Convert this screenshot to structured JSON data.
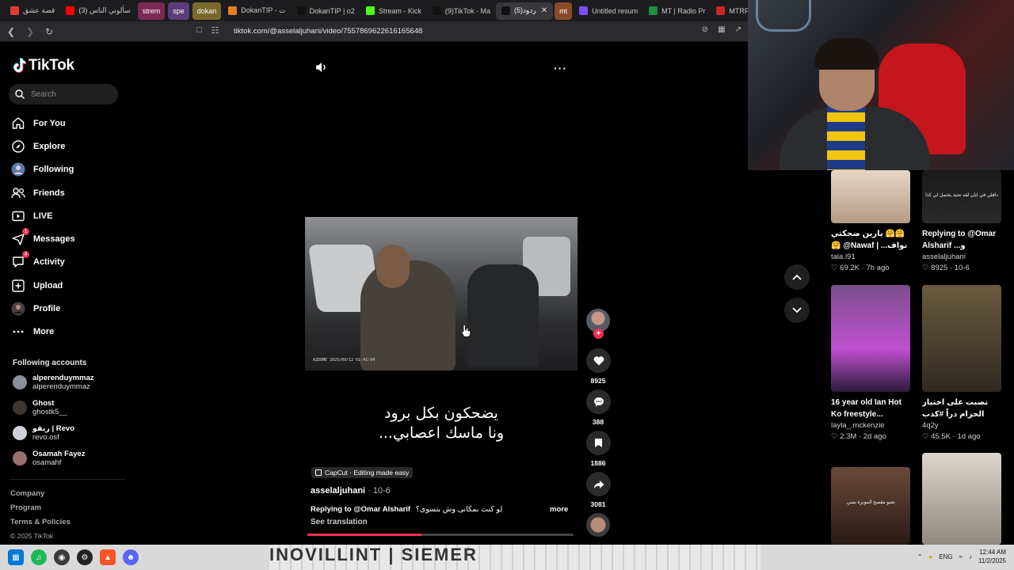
{
  "browser": {
    "tabs": [
      {
        "label": "قصة عشق",
        "color": "#e53935",
        "type": "tab"
      },
      {
        "label": "(3) سألوني الناس",
        "color": "#ff0000",
        "type": "tab"
      },
      {
        "label": "strem",
        "color": "#7a2a55",
        "type": "chip"
      },
      {
        "label": "spe",
        "color": "#5a3d7a",
        "type": "chip"
      },
      {
        "label": "dokan",
        "color": "#7a6a2a",
        "type": "chip"
      },
      {
        "label": "DokanTIP - ت",
        "color": "#e67e22",
        "type": "tab"
      },
      {
        "label": "DokanTIP | o2",
        "color": "#111111",
        "type": "tab"
      },
      {
        "label": "Stream - Kick",
        "color": "#53fc18",
        "type": "tab"
      },
      {
        "label": "(9)TikTok - Ma",
        "color": "#111111",
        "type": "tab"
      },
      {
        "label": "(5)ردود",
        "color": "#111111",
        "type": "active"
      },
      {
        "label": "mt",
        "color": "#8a4a2a",
        "type": "chip"
      },
      {
        "label": "Untitled resum",
        "color": "#7c4dff",
        "type": "tab"
      },
      {
        "label": "MT | Radio Pr",
        "color": "#1e8e3e",
        "type": "tab"
      },
      {
        "label": "MTRP",
        "color": "#c62828",
        "type": "tab"
      }
    ],
    "url": "tiktok.com/@asselaljuhani/video/7557869622616165648"
  },
  "sidebar": {
    "brand": "TikTok",
    "search_placeholder": "Search",
    "nav": [
      {
        "label": "For You",
        "icon": "home-icon"
      },
      {
        "label": "Explore",
        "icon": "compass-icon"
      },
      {
        "label": "Following",
        "icon": "following-avatar-icon"
      },
      {
        "label": "Friends",
        "icon": "friends-icon"
      },
      {
        "label": "LIVE",
        "icon": "live-icon"
      },
      {
        "label": "Messages",
        "icon": "messages-icon",
        "badge": "1"
      },
      {
        "label": "Activity",
        "icon": "activity-icon",
        "badge": "4"
      },
      {
        "label": "Upload",
        "icon": "upload-icon"
      },
      {
        "label": "Profile",
        "icon": "profile-avatar-icon"
      },
      {
        "label": "More",
        "icon": "more-icon"
      }
    ],
    "following_title": "Following accounts",
    "accounts": [
      {
        "name": "alperenduymmaz",
        "handle": "alperenduymmaz",
        "color": "#8a8f99"
      },
      {
        "name": "Ghost",
        "handle": "ghostk5__",
        "color": "#3d3530"
      },
      {
        "name": "ريفو | Revo",
        "handle": "revo.osf",
        "color": "#d0d4da"
      },
      {
        "name": "Osamah Fayez",
        "handle": "osamahf",
        "color": "#9a6f6f"
      }
    ],
    "footer": [
      "Company",
      "Program",
      "Terms & Policies"
    ],
    "copyright": "© 2025 TikTok"
  },
  "video": {
    "caption_line1": "يضحكون بكل برود",
    "caption_line2": "ونا ماسك اعصابي...",
    "capcut_label": "CapCut · Editing made easy",
    "author": "asselaljuhani",
    "date": "10-6",
    "reply_prefix": "Replying to @Omar Alsharif",
    "reply_text": "لو كنت بمكانى وش بتسوى؟",
    "more_label": "more",
    "see_translation": "See translation",
    "progress_fraction": 0.43,
    "stamp": "AZDOME 2025/09/12 01:41:04"
  },
  "actions": {
    "likes": "8925",
    "comments": "388",
    "saves": "1886",
    "shares": "3081"
  },
  "suggestions": [
    {
      "title": "يارين ضحكتي 🤗🤗🤗 @Nawaf | ...نواف",
      "author": "tala.i91",
      "likes": "69.2K",
      "age": "7h ago",
      "bg": "linear-gradient(180deg,#e7d6c7,#b49b86)",
      "overlay": ""
    },
    {
      "title": "Replying to @Omar Alsharif ...و",
      "author": "asselaljuhani",
      "likes": "8925",
      "age": "10-6",
      "bg": "linear-gradient(180deg,#1a1a1a,#2a2a2a)",
      "overlay": "دافلي في ابان لقه تحية بختمل لي كذا"
    },
    {
      "title": "16 year old Ian Hot Ko freestyle...",
      "author": "layla_.mckenzie",
      "likes": "2.3M",
      "age": "2d ago",
      "bg": "linear-gradient(180deg,#7b4f8c,#c04fd1 60%,#2a1a3a)",
      "overlay": ""
    },
    {
      "title": "نصبت على اختيار الحزام دراً #كذب هييييييه",
      "author": "4q2y",
      "likes": "45.5K",
      "age": "1d ago",
      "bg": "linear-gradient(180deg,#6a5a3e,#2f2a20)",
      "overlay": ""
    },
    {
      "title": "",
      "author": "",
      "likes": "",
      "age": "",
      "bg": "linear-gradient(180deg,#6a4a3a,#2a1a14)",
      "overlay": "شنو مقصح الموبرة بسي"
    },
    {
      "title": "",
      "author": "",
      "likes": "",
      "age": "",
      "bg": "linear-gradient(180deg,#dcd6cc,#8f887e)",
      "overlay": ""
    }
  ],
  "taskbar": {
    "lang": "ENG",
    "time": "12:44 AM",
    "date": "11/2/2025",
    "banner_text": "INOVILLINT | SIEMER"
  }
}
